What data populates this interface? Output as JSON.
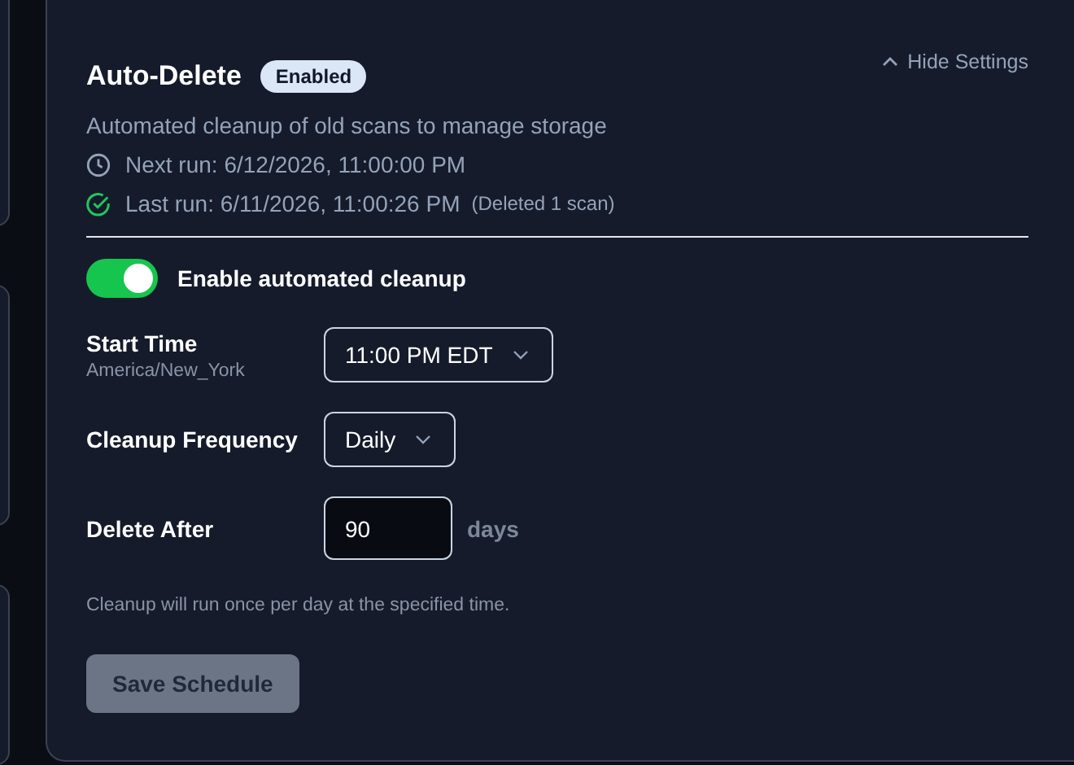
{
  "header": {
    "title": "Auto-Delete",
    "badge": "Enabled",
    "settings_link": {
      "label": "Hide Settings",
      "expanded": true
    }
  },
  "description": "Automated cleanup of old scans to manage storage",
  "runs": [
    {
      "kind": "next",
      "label": "Next run: 6/12/2026, 11:00:00 PM"
    },
    {
      "kind": "last",
      "label": "Last run: 6/11/2026, 11:00:26 PM",
      "note": "(Deleted 1 scan)"
    }
  ],
  "enable": {
    "label": "Enable automated cleanup",
    "on": true
  },
  "fields": [
    {
      "kind": "select",
      "label": "Start Time",
      "sublabel": "America/New_York",
      "value": "11:00 PM EDT"
    },
    {
      "kind": "select",
      "label": "Cleanup Frequency",
      "value": "Daily"
    },
    {
      "kind": "number",
      "label": "Delete After",
      "value": "90",
      "unit": "days"
    }
  ],
  "hint": "Cleanup will run once per day at the specified time.",
  "save_button": {
    "label": "Save Schedule",
    "disabled": true
  }
}
